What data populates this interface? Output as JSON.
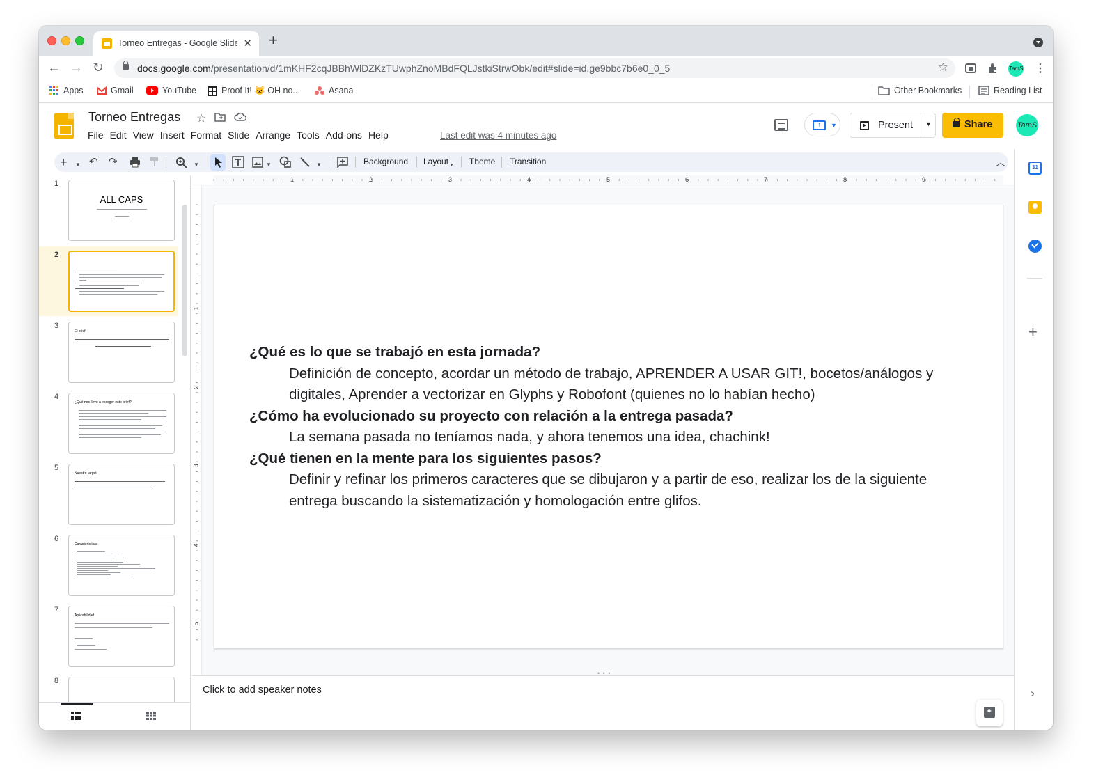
{
  "browser": {
    "tab_title": "Torneo Entregas - Google Slides",
    "url_host": "docs.google.com",
    "url_path": "/presentation/d/1mKHF2cqJBBhWlDZKzTUwphZnoMBdFQLJstkiStrwObk/edit#slide=id.ge9bbc7b6e0_0_5",
    "avatar_initials": "TamS",
    "new_tab": "+"
  },
  "bookmarks": {
    "items": [
      {
        "label": "Apps",
        "icon": "apps-grid-icon"
      },
      {
        "label": "Gmail",
        "icon": "gmail-icon"
      },
      {
        "label": "YouTube",
        "icon": "youtube-icon"
      },
      {
        "label": "Proof It! 😺 OH no...",
        "icon": "proofit-icon"
      },
      {
        "label": "Asana",
        "icon": "asana-icon"
      }
    ],
    "other": "Other Bookmarks",
    "reading_list": "Reading List"
  },
  "app": {
    "title": "Torneo Entregas",
    "menus": [
      "File",
      "Edit",
      "View",
      "Insert",
      "Format",
      "Slide",
      "Arrange",
      "Tools",
      "Add-ons",
      "Help"
    ],
    "last_edit": "Last edit was 4 minutes ago",
    "present_label": "Present",
    "share_label": "Share",
    "account_initials": "TamS"
  },
  "toolbar": {
    "background": "Background",
    "layout": "Layout",
    "theme": "Theme",
    "transition": "Transition"
  },
  "ruler": {
    "h_numbers": [
      "1",
      "2",
      "3",
      "4",
      "5",
      "6",
      "7",
      "8",
      "9"
    ],
    "v_numbers": [
      "1",
      "2",
      "3",
      "4",
      "5"
    ]
  },
  "filmstrip": {
    "slides": [
      {
        "num": "1",
        "title": "ALL CAPS",
        "selected": false
      },
      {
        "num": "2",
        "title": "",
        "selected": true
      },
      {
        "num": "3",
        "title": "El brief",
        "selected": false
      },
      {
        "num": "4",
        "title": "¿Qué nos llevó a escoger este brief?",
        "selected": false
      },
      {
        "num": "5",
        "title": "Nuestro target",
        "selected": false
      },
      {
        "num": "6",
        "title": "Características",
        "selected": false
      },
      {
        "num": "7",
        "title": "Aplicabilidad",
        "selected": false
      },
      {
        "num": "8",
        "title": "",
        "selected": false
      }
    ]
  },
  "slide": {
    "q1": "¿Qué es lo que se trabajó en esta jornada?",
    "a1": "Definición de concepto, acordar un método de trabajo, APRENDER A USAR GIT!, bocetos/análogos y digitales, Aprender a vectorizar en Glyphs y Robofont (quienes no lo habían hecho)",
    "q2": "¿Cómo ha evolucionado su proyecto con relación a la entrega pasada?",
    "a2": "La semana pasada no teníamos nada, y ahora tenemos una idea, chachink!",
    "q3": "¿Qué tienen en la mente para los siguientes pasos?",
    "a3": "Definir y refinar los primeros caracteres que se dibujaron y a partir de eso, realizar los de la siguiente entrega buscando la sistematización y homologación entre glifos."
  },
  "notes": {
    "placeholder": "Click to add speaker notes"
  },
  "side_panel": {
    "calendar_day": "31"
  },
  "colors": {
    "accent_yellow": "#fbbc04",
    "selection_blue": "#1a73e8"
  }
}
